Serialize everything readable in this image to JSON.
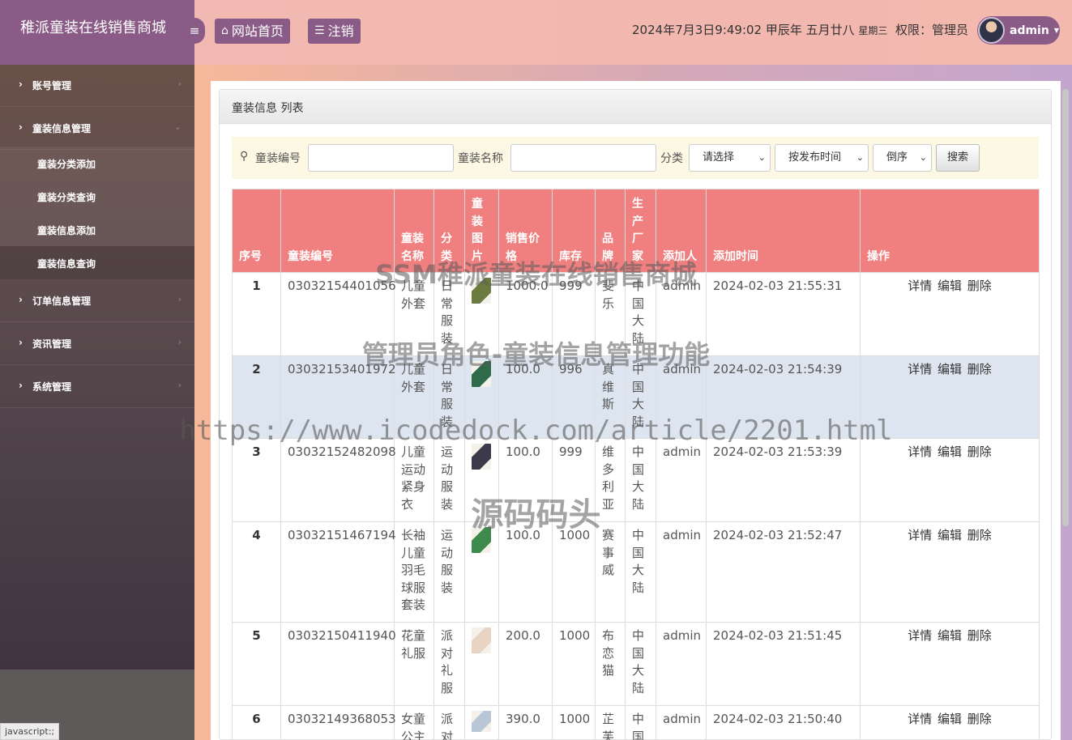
{
  "app": {
    "title": "稚派童装在线销售商城"
  },
  "header": {
    "menu_toggle_icon": "bars-icon",
    "home_label": "网站首页",
    "logout_label": "注销",
    "datetime": "2024年7月3日9:49:02 甲辰年 五月廿八",
    "weekday": "星期三",
    "role_label": "权限：管理员",
    "user_name": "admin"
  },
  "sidebar": {
    "items": [
      {
        "label": "账号管理"
      },
      {
        "label": "童装信息管理"
      },
      {
        "label": "订单信息管理"
      },
      {
        "label": "资讯管理"
      },
      {
        "label": "系统管理"
      }
    ],
    "sub_items": [
      {
        "label": "童装分类添加"
      },
      {
        "label": "童装分类查询"
      },
      {
        "label": "童装信息添加"
      },
      {
        "label": "童装信息查询"
      }
    ]
  },
  "panel": {
    "title": "童装信息 列表"
  },
  "search": {
    "code_label": "童装编号",
    "name_label": "童装名称",
    "category_label": "分类",
    "category_value": "请选择",
    "sort_value": "按发布时间",
    "order_value": "倒序",
    "button_label": "搜索"
  },
  "table": {
    "headers": [
      "序号",
      "童装编号",
      "童装名称",
      "分类",
      "童装图片",
      "销售价格",
      "库存",
      "品牌",
      "生产厂家",
      "添加人",
      "添加时间",
      "操作"
    ],
    "ops": {
      "detail": "详情",
      "edit": "编辑",
      "delete": "删除"
    },
    "rows": [
      {
        "idx": "1",
        "code": "03032154401056",
        "name": "儿童外套",
        "category": "日常服装",
        "price": "1000.0",
        "stock": "999",
        "brand": "斐乐",
        "maker": "中国大陆",
        "adder": "admin",
        "time": "2024-02-03 21:55:31",
        "img_color": "#6b7a3f"
      },
      {
        "idx": "2",
        "code": "03032153401972",
        "name": "儿童外套",
        "category": "日常服装",
        "price": "100.0",
        "stock": "996",
        "brand": "真维斯",
        "maker": "中国大陆",
        "adder": "admin",
        "time": "2024-02-03 21:54:39",
        "img_color": "#2f6b4a"
      },
      {
        "idx": "3",
        "code": "03032152482098",
        "name": "儿童运动紧身衣",
        "category": "运动服装",
        "price": "100.0",
        "stock": "999",
        "brand": "维多利亚",
        "maker": "中国大陆",
        "adder": "admin",
        "time": "2024-02-03 21:53:39",
        "img_color": "#3a3a4a"
      },
      {
        "idx": "4",
        "code": "03032151467194",
        "name": "长袖儿童羽毛球服套装",
        "category": "运动服装",
        "price": "100.0",
        "stock": "1000",
        "brand": "赛事威",
        "maker": "中国大陆",
        "adder": "admin",
        "time": "2024-02-03 21:52:47",
        "img_color": "#3d8a4c"
      },
      {
        "idx": "5",
        "code": "03032150411940",
        "name": "花童礼服",
        "category": "派对礼服",
        "price": "200.0",
        "stock": "1000",
        "brand": "布恋猫",
        "maker": "中国大陆",
        "adder": "admin",
        "time": "2024-02-03 21:51:45",
        "img_color": "#e9d3c2"
      },
      {
        "idx": "6",
        "code": "03032149368053",
        "name": "女童公主",
        "category": "派对",
        "price": "390.0",
        "stock": "1000",
        "brand": "芷芙",
        "maker": "中国",
        "adder": "admin",
        "time": "2024-02-03 21:50:40",
        "img_color": "#b9c6d6"
      }
    ]
  },
  "status_bar": {
    "text": "javascript:;"
  },
  "watermark": {
    "line1": "SSM稚派童装在线销售商城",
    "line2": "管理员角色-童装信息管理功能",
    "line3": "https://www.icodedock.com/article/2201.html",
    "line4": "源码码头"
  }
}
